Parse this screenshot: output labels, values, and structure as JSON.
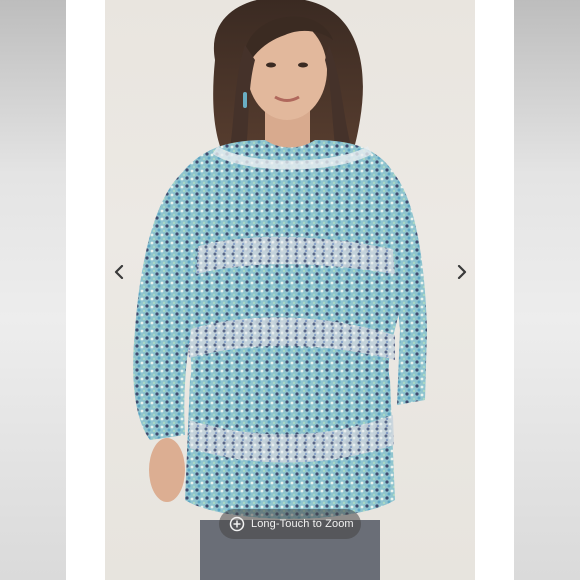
{
  "viewer": {
    "zoom_hint": "Long-Touch to Zoom",
    "prev_icon": "chevron-left-icon",
    "next_icon": "chevron-right-icon",
    "zoom_icon": "zoom-in-icon",
    "colors": {
      "sweater_teal": "#6fb5c9",
      "sweater_navy": "#3e4a6e",
      "sweater_mint": "#a9d8c4",
      "background": "#e9e5df"
    }
  }
}
